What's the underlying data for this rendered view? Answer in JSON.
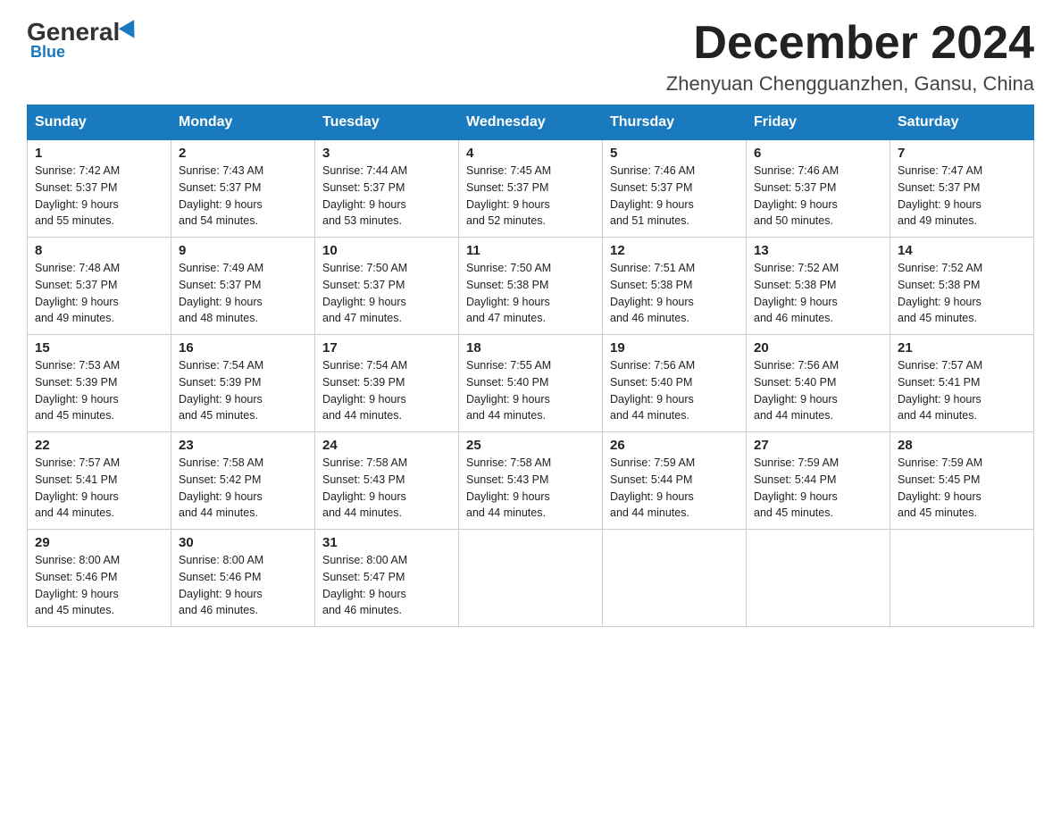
{
  "logo": {
    "general": "General",
    "blue": "Blue"
  },
  "title": {
    "month_year": "December 2024",
    "location": "Zhenyuan Chengguanzhen, Gansu, China"
  },
  "days_of_week": [
    "Sunday",
    "Monday",
    "Tuesday",
    "Wednesday",
    "Thursday",
    "Friday",
    "Saturday"
  ],
  "weeks": [
    [
      {
        "day": "1",
        "sunrise": "7:42 AM",
        "sunset": "5:37 PM",
        "daylight": "9 hours and 55 minutes."
      },
      {
        "day": "2",
        "sunrise": "7:43 AM",
        "sunset": "5:37 PM",
        "daylight": "9 hours and 54 minutes."
      },
      {
        "day": "3",
        "sunrise": "7:44 AM",
        "sunset": "5:37 PM",
        "daylight": "9 hours and 53 minutes."
      },
      {
        "day": "4",
        "sunrise": "7:45 AM",
        "sunset": "5:37 PM",
        "daylight": "9 hours and 52 minutes."
      },
      {
        "day": "5",
        "sunrise": "7:46 AM",
        "sunset": "5:37 PM",
        "daylight": "9 hours and 51 minutes."
      },
      {
        "day": "6",
        "sunrise": "7:46 AM",
        "sunset": "5:37 PM",
        "daylight": "9 hours and 50 minutes."
      },
      {
        "day": "7",
        "sunrise": "7:47 AM",
        "sunset": "5:37 PM",
        "daylight": "9 hours and 49 minutes."
      }
    ],
    [
      {
        "day": "8",
        "sunrise": "7:48 AM",
        "sunset": "5:37 PM",
        "daylight": "9 hours and 49 minutes."
      },
      {
        "day": "9",
        "sunrise": "7:49 AM",
        "sunset": "5:37 PM",
        "daylight": "9 hours and 48 minutes."
      },
      {
        "day": "10",
        "sunrise": "7:50 AM",
        "sunset": "5:37 PM",
        "daylight": "9 hours and 47 minutes."
      },
      {
        "day": "11",
        "sunrise": "7:50 AM",
        "sunset": "5:38 PM",
        "daylight": "9 hours and 47 minutes."
      },
      {
        "day": "12",
        "sunrise": "7:51 AM",
        "sunset": "5:38 PM",
        "daylight": "9 hours and 46 minutes."
      },
      {
        "day": "13",
        "sunrise": "7:52 AM",
        "sunset": "5:38 PM",
        "daylight": "9 hours and 46 minutes."
      },
      {
        "day": "14",
        "sunrise": "7:52 AM",
        "sunset": "5:38 PM",
        "daylight": "9 hours and 45 minutes."
      }
    ],
    [
      {
        "day": "15",
        "sunrise": "7:53 AM",
        "sunset": "5:39 PM",
        "daylight": "9 hours and 45 minutes."
      },
      {
        "day": "16",
        "sunrise": "7:54 AM",
        "sunset": "5:39 PM",
        "daylight": "9 hours and 45 minutes."
      },
      {
        "day": "17",
        "sunrise": "7:54 AM",
        "sunset": "5:39 PM",
        "daylight": "9 hours and 44 minutes."
      },
      {
        "day": "18",
        "sunrise": "7:55 AM",
        "sunset": "5:40 PM",
        "daylight": "9 hours and 44 minutes."
      },
      {
        "day": "19",
        "sunrise": "7:56 AM",
        "sunset": "5:40 PM",
        "daylight": "9 hours and 44 minutes."
      },
      {
        "day": "20",
        "sunrise": "7:56 AM",
        "sunset": "5:40 PM",
        "daylight": "9 hours and 44 minutes."
      },
      {
        "day": "21",
        "sunrise": "7:57 AM",
        "sunset": "5:41 PM",
        "daylight": "9 hours and 44 minutes."
      }
    ],
    [
      {
        "day": "22",
        "sunrise": "7:57 AM",
        "sunset": "5:41 PM",
        "daylight": "9 hours and 44 minutes."
      },
      {
        "day": "23",
        "sunrise": "7:58 AM",
        "sunset": "5:42 PM",
        "daylight": "9 hours and 44 minutes."
      },
      {
        "day": "24",
        "sunrise": "7:58 AM",
        "sunset": "5:43 PM",
        "daylight": "9 hours and 44 minutes."
      },
      {
        "day": "25",
        "sunrise": "7:58 AM",
        "sunset": "5:43 PM",
        "daylight": "9 hours and 44 minutes."
      },
      {
        "day": "26",
        "sunrise": "7:59 AM",
        "sunset": "5:44 PM",
        "daylight": "9 hours and 44 minutes."
      },
      {
        "day": "27",
        "sunrise": "7:59 AM",
        "sunset": "5:44 PM",
        "daylight": "9 hours and 45 minutes."
      },
      {
        "day": "28",
        "sunrise": "7:59 AM",
        "sunset": "5:45 PM",
        "daylight": "9 hours and 45 minutes."
      }
    ],
    [
      {
        "day": "29",
        "sunrise": "8:00 AM",
        "sunset": "5:46 PM",
        "daylight": "9 hours and 45 minutes."
      },
      {
        "day": "30",
        "sunrise": "8:00 AM",
        "sunset": "5:46 PM",
        "daylight": "9 hours and 46 minutes."
      },
      {
        "day": "31",
        "sunrise": "8:00 AM",
        "sunset": "5:47 PM",
        "daylight": "9 hours and 46 minutes."
      },
      null,
      null,
      null,
      null
    ]
  ],
  "labels": {
    "sunrise": "Sunrise:",
    "sunset": "Sunset:",
    "daylight": "Daylight:"
  }
}
